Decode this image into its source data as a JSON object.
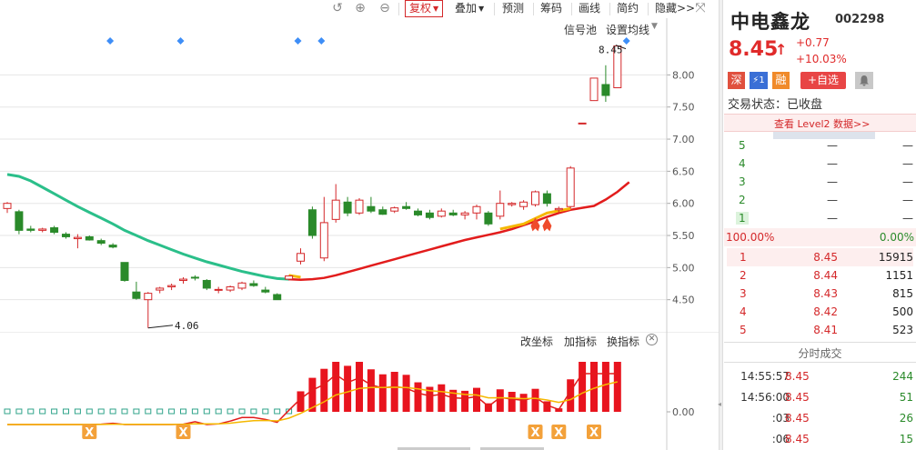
{
  "toolbar": {
    "back_icon": "undo-icon",
    "zoom_in_icon": "zoom-in-icon",
    "zoom_out_icon": "zoom-out-icon",
    "fuquan": "复权",
    "diejia": "叠加",
    "yuce": "预测",
    "chouma": "筹码",
    "huaxian": "画线",
    "jianyue": "简约",
    "yincang": "隐藏>>",
    "expand_icon": "expand-icon"
  },
  "main_chart": {
    "signal_pool": "信号池",
    "set_ma": "设置均线",
    "high_label": "8.45",
    "low_label": "4.06",
    "y_ticks": [
      "8.00",
      "7.50",
      "7.00",
      "6.50",
      "6.00",
      "5.50",
      "5.00",
      "4.50"
    ],
    "colors": {
      "up": "#d4282a",
      "down": "#2a8a2a",
      "ma_green": "#2bbf8a",
      "ma_red": "#e21c1c",
      "ma_yellow": "#f5b800",
      "signal": "#3e8ef7"
    }
  },
  "indicator": {
    "change_axis": "改坐标",
    "add_indicator": "加指标",
    "switch_indicator": "换指标",
    "close_icon": "close-circle-icon",
    "y_tick": "0.00",
    "signal_marker_text": "X"
  },
  "chart_data": {
    "type": "candlestick",
    "ylim": [
      4.0,
      8.6
    ],
    "candles": [
      {
        "o": 5.92,
        "h": 6.02,
        "l": 5.85,
        "c": 6.0
      },
      {
        "o": 5.87,
        "h": 5.9,
        "l": 5.52,
        "c": 5.58
      },
      {
        "o": 5.6,
        "h": 5.65,
        "l": 5.55,
        "c": 5.58
      },
      {
        "o": 5.58,
        "h": 5.62,
        "l": 5.55,
        "c": 5.6
      },
      {
        "o": 5.62,
        "h": 5.65,
        "l": 5.52,
        "c": 5.55
      },
      {
        "o": 5.52,
        "h": 5.55,
        "l": 5.45,
        "c": 5.48
      },
      {
        "o": 5.45,
        "h": 5.52,
        "l": 5.3,
        "c": 5.47
      },
      {
        "o": 5.48,
        "h": 5.5,
        "l": 5.42,
        "c": 5.43
      },
      {
        "o": 5.42,
        "h": 5.45,
        "l": 5.35,
        "c": 5.38
      },
      {
        "o": 5.35,
        "h": 5.38,
        "l": 5.3,
        "c": 5.32
      },
      {
        "o": 5.08,
        "h": 5.08,
        "l": 4.78,
        "c": 4.8
      },
      {
        "o": 4.62,
        "h": 4.78,
        "l": 4.5,
        "c": 4.52
      },
      {
        "o": 4.5,
        "h": 4.62,
        "l": 4.06,
        "c": 4.6
      },
      {
        "o": 4.65,
        "h": 4.7,
        "l": 4.6,
        "c": 4.68
      },
      {
        "o": 4.7,
        "h": 4.75,
        "l": 4.65,
        "c": 4.72
      },
      {
        "o": 4.8,
        "h": 4.85,
        "l": 4.75,
        "c": 4.82
      },
      {
        "o": 4.85,
        "h": 4.88,
        "l": 4.8,
        "c": 4.84
      },
      {
        "o": 4.8,
        "h": 4.82,
        "l": 4.65,
        "c": 4.68
      },
      {
        "o": 4.65,
        "h": 4.7,
        "l": 4.6,
        "c": 4.66
      },
      {
        "o": 4.65,
        "h": 4.72,
        "l": 4.62,
        "c": 4.7
      },
      {
        "o": 4.68,
        "h": 4.78,
        "l": 4.65,
        "c": 4.76
      },
      {
        "o": 4.75,
        "h": 4.8,
        "l": 4.7,
        "c": 4.72
      },
      {
        "o": 4.65,
        "h": 4.7,
        "l": 4.6,
        "c": 4.62
      },
      {
        "o": 4.58,
        "h": 4.6,
        "l": 4.5,
        "c": 4.5
      },
      {
        "o": 4.82,
        "h": 4.88,
        "l": 4.8,
        "c": 4.87
      },
      {
        "o": 5.1,
        "h": 5.3,
        "l": 5.05,
        "c": 5.22
      },
      {
        "o": 5.9,
        "h": 5.95,
        "l": 5.45,
        "c": 5.5
      },
      {
        "o": 5.15,
        "h": 6.1,
        "l": 5.1,
        "c": 5.7
      },
      {
        "o": 5.75,
        "h": 6.3,
        "l": 5.7,
        "c": 6.05
      },
      {
        "o": 6.02,
        "h": 6.1,
        "l": 5.8,
        "c": 5.85
      },
      {
        "o": 5.85,
        "h": 6.08,
        "l": 5.82,
        "c": 6.05
      },
      {
        "o": 5.95,
        "h": 6.1,
        "l": 5.85,
        "c": 5.88
      },
      {
        "o": 5.9,
        "h": 5.95,
        "l": 5.82,
        "c": 5.83
      },
      {
        "o": 5.88,
        "h": 5.95,
        "l": 5.85,
        "c": 5.93
      },
      {
        "o": 5.95,
        "h": 6.02,
        "l": 5.9,
        "c": 5.92
      },
      {
        "o": 5.88,
        "h": 5.92,
        "l": 5.8,
        "c": 5.82
      },
      {
        "o": 5.85,
        "h": 5.9,
        "l": 5.75,
        "c": 5.78
      },
      {
        "o": 5.8,
        "h": 5.92,
        "l": 5.78,
        "c": 5.88
      },
      {
        "o": 5.85,
        "h": 5.9,
        "l": 5.8,
        "c": 5.82
      },
      {
        "o": 5.82,
        "h": 5.88,
        "l": 5.75,
        "c": 5.85
      },
      {
        "o": 5.85,
        "h": 5.98,
        "l": 5.75,
        "c": 5.95
      },
      {
        "o": 5.85,
        "h": 5.88,
        "l": 5.65,
        "c": 5.68
      },
      {
        "o": 5.8,
        "h": 6.2,
        "l": 5.75,
        "c": 6.0
      },
      {
        "o": 5.98,
        "h": 6.02,
        "l": 5.95,
        "c": 6.0
      },
      {
        "o": 5.95,
        "h": 6.05,
        "l": 5.9,
        "c": 6.02
      },
      {
        "o": 5.98,
        "h": 6.2,
        "l": 5.95,
        "c": 6.18
      },
      {
        "o": 6.15,
        "h": 6.2,
        "l": 5.95,
        "c": 6.0
      },
      {
        "o": 5.9,
        "h": 5.95,
        "l": 5.85,
        "c": 5.92
      },
      {
        "o": 5.95,
        "h": 6.58,
        "l": 5.92,
        "c": 6.55
      },
      {
        "o": 7.25,
        "h": 7.25,
        "l": 7.25,
        "c": 7.25
      },
      {
        "o": 7.6,
        "h": 7.95,
        "l": 7.6,
        "c": 7.95
      },
      {
        "o": 7.85,
        "h": 8.15,
        "l": 7.58,
        "c": 7.68
      },
      {
        "o": 7.8,
        "h": 8.45,
        "l": 7.8,
        "c": 8.45
      }
    ]
  },
  "stock": {
    "name": "中电鑫龙",
    "code": "002298",
    "price": "8.45",
    "up_icon": "up-arrow-icon",
    "change": "+0.77",
    "change_pct": "+10.03%",
    "badge_shen": "深",
    "badge_flash": "⚡1",
    "badge_rong": "融",
    "add_watch": "+自选",
    "bell_icon": "alarm-icon",
    "status": "交易状态：已收盘",
    "level2_link": "查看 Level2 数据>>"
  },
  "order_book": {
    "asks": [
      {
        "level": "5",
        "price": "—",
        "vol": "—"
      },
      {
        "level": "4",
        "price": "—",
        "vol": "—"
      },
      {
        "level": "3",
        "price": "—",
        "vol": "—"
      },
      {
        "level": "2",
        "price": "—",
        "vol": "—"
      },
      {
        "level": "1",
        "price": "—",
        "vol": "—"
      }
    ],
    "ratio_left": "100.00%",
    "ratio_right": "0.00%",
    "bids": [
      {
        "level": "1",
        "price": "8.45",
        "vol": "15915"
      },
      {
        "level": "2",
        "price": "8.44",
        "vol": "1151"
      },
      {
        "level": "3",
        "price": "8.43",
        "vol": "815"
      },
      {
        "level": "4",
        "price": "8.42",
        "vol": "500"
      },
      {
        "level": "5",
        "price": "8.41",
        "vol": "523"
      }
    ]
  },
  "ticks": {
    "title": "分时成交",
    "rows": [
      {
        "time": "14:55:57",
        "price": "8.45",
        "vol": "244",
        "color": "green"
      },
      {
        "time": "14:56:00",
        "price": "8.45",
        "vol": "51",
        "color": "green"
      },
      {
        "time": ":03",
        "price": "8.45",
        "vol": "26",
        "color": "green"
      },
      {
        "time": ":06",
        "price": "8.45",
        "vol": "15",
        "color": "green"
      }
    ]
  }
}
